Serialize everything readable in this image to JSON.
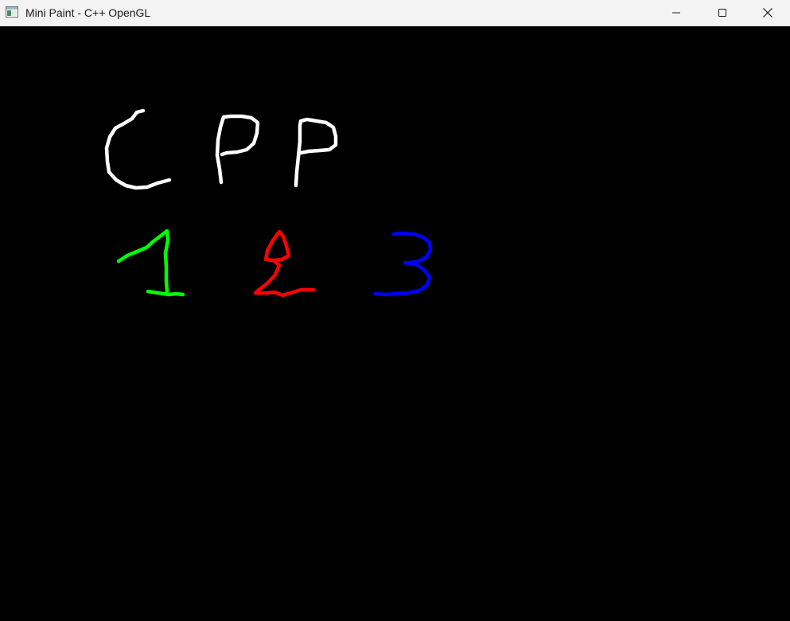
{
  "window": {
    "title": "Mini Paint - C++ OpenGL",
    "controls": {
      "minimize": "minimize-icon",
      "maximize": "maximize-icon",
      "close": "close-icon"
    }
  },
  "canvas": {
    "background": "#000000"
  },
  "strokes": [
    {
      "id": "letter-c",
      "color": "#ffffff"
    },
    {
      "id": "letter-p-first",
      "color": "#ffffff"
    },
    {
      "id": "letter-p-second",
      "color": "#ffffff"
    },
    {
      "id": "digit-1",
      "color": "#00ff00"
    },
    {
      "id": "digit-2",
      "color": "#ff0000"
    },
    {
      "id": "digit-3",
      "color": "#0000ff"
    }
  ]
}
